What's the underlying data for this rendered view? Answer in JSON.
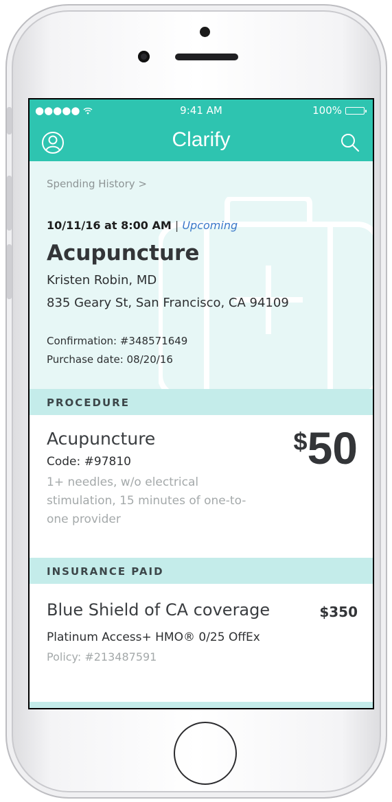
{
  "status_bar": {
    "signal": "●●●●● ",
    "time": "9:41 AM",
    "battery": "100%"
  },
  "nav": {
    "title": "Clarify",
    "left_icon": "profile-icon",
    "right_icon": "search-icon"
  },
  "hero": {
    "breadcrumb": "Spending History >",
    "date": "10/11/16 at 8:00 AM",
    "separator": "|",
    "status": "Upcoming",
    "title": "Acupuncture",
    "provider": "Kristen Robin, MD",
    "address": "835 Geary St, San Francisco, CA 94109",
    "confirmation": "Confirmation: #348571649",
    "purchase_date": "Purchase date: 08/20/16",
    "watermark_icon": "medical-kit-icon"
  },
  "procedure": {
    "header": "PROCEDURE",
    "name": "Acupuncture",
    "code": "Code: #97810",
    "description": "1+ needles, w/o electrical stimulation, 15 minutes of one-to-one provider",
    "price_currency": "$",
    "price_amount": "50"
  },
  "insurance": {
    "header": "INSURANCE PAID",
    "name": "Blue Shield of CA coverage",
    "amount": "$350",
    "plan": "Platinum Access+ HMO® 0/25 OffEx",
    "policy": "Policy: #213487591"
  },
  "colors": {
    "primary": "#2ec4b0",
    "hero_bg": "#e7f7f6",
    "section_bg": "#c4ecea",
    "link": "#3a78c9"
  }
}
